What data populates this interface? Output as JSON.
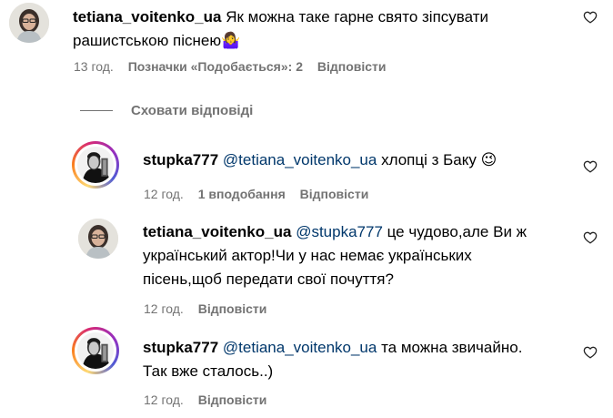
{
  "comments": [
    {
      "username": "tetiana_voitenko_ua",
      "text_line1": "Як можна таке гарне свято зіпсувати",
      "text_line2": "рашистською піснею🤷‍♀",
      "time": "13 год.",
      "likes": "Позначки «Подобається»: 2",
      "reply": "Відповісти"
    }
  ],
  "hide_replies": "Сховати відповіді",
  "replies": [
    {
      "username": "stupka777",
      "mention": "@tetiana_voitenko_ua",
      "text_line1": "хлопці з Баку",
      "emoji": "😉",
      "time": "12 год.",
      "likes": "1 вподобання",
      "reply": "Відповісти"
    },
    {
      "username": "tetiana_voitenko_ua",
      "mention": "@stupka777",
      "text_line1": "це чудово,але Ви ж",
      "text_line2": "український актор!Чи у нас немає українських",
      "text_line3": "пісень,щоб передати свої почуття?",
      "time": "12 год.",
      "reply": "Відповісти"
    },
    {
      "username": "stupka777",
      "mention": "@tetiana_voitenko_ua",
      "text_line1": "та можна звичайно.",
      "text_line2": "Так вже сталось..)",
      "time": "12 год.",
      "reply": "Відповісти"
    }
  ],
  "icons": {
    "like": "heart-outline-icon"
  },
  "colors": {
    "meta": "#737373",
    "mention": "#00376b"
  }
}
